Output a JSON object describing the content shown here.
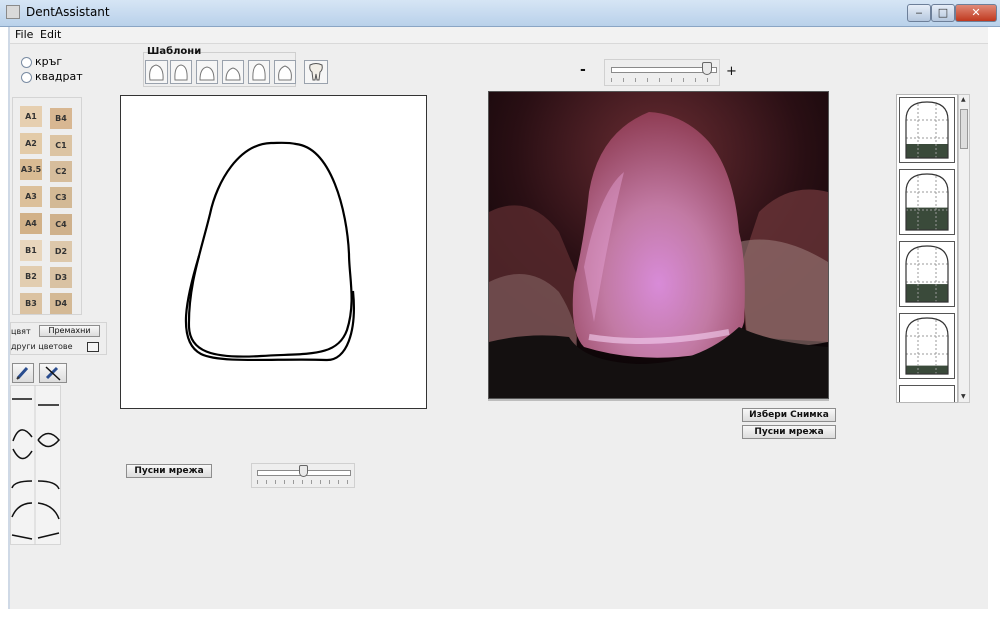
{
  "window": {
    "title": "DentAssistant"
  },
  "menu": {
    "file": "File",
    "edit": "Edit"
  },
  "shape_options": {
    "circle_label": "кръг",
    "square_label": "квадрат"
  },
  "shades": {
    "col1": [
      "A1",
      "A2",
      "A3.5",
      "A3",
      "A4",
      "B1",
      "B2",
      "B3"
    ],
    "col2": [
      "B4",
      "C1",
      "C2",
      "C3",
      "C4",
      "D2",
      "D3",
      "D4"
    ],
    "col1_colors": [
      "#e6cfb0",
      "#e3cba8",
      "#d9bb93",
      "#dcc09a",
      "#d2b188",
      "#e8d6bd",
      "#e2cdb0",
      "#dbc2a1"
    ],
    "col2_colors": [
      "#d8b792",
      "#dcc4a3",
      "#d6bd9c",
      "#d3b995",
      "#cfb18c",
      "#ddc8ab",
      "#d9c2a3",
      "#d4b995"
    ]
  },
  "color_controls": {
    "color_label": "цвят",
    "remove_button": "Премахни",
    "other_colors_label": "други цветове"
  },
  "templates": {
    "label": "Шаблони"
  },
  "zoom": {
    "minus": "-",
    "plus": "+",
    "value_fraction": 0.92
  },
  "buttons": {
    "choose_photo": "Избери Снимка",
    "grid_right": "Пусни мрежа",
    "grid_left": "Пусни мрежа"
  },
  "opacity_slider": {
    "value_fraction": 0.5
  },
  "thumbnails": {
    "fill_levels": [
      0.25,
      0.4,
      0.32,
      0.15
    ],
    "fill_color": "#3a4a3a"
  },
  "colors": {
    "accent": "#c0391f"
  }
}
